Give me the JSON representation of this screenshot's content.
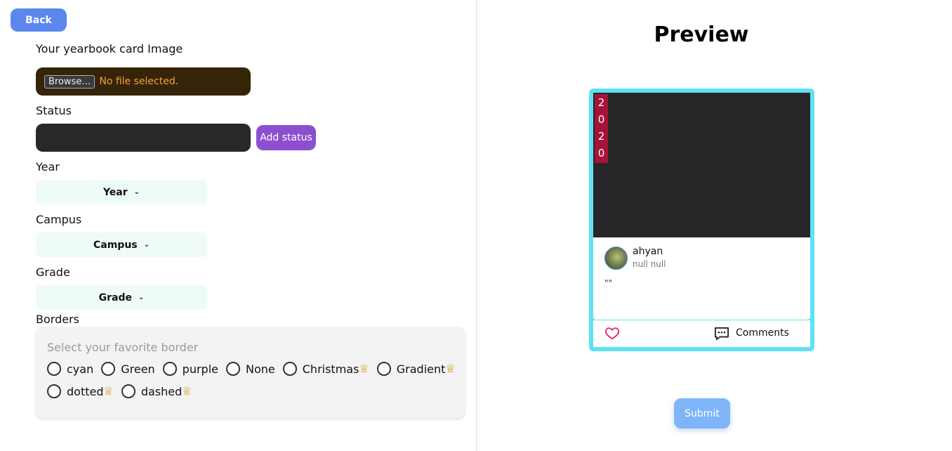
{
  "nav": {
    "back_label": "Back"
  },
  "form": {
    "image_label": "Your yearbook card Image",
    "file_button": "Browse…",
    "file_status": "No file selected.",
    "status_label": "Status",
    "status_value": "",
    "add_status_label": "Add status",
    "year_label": "Year",
    "year_selected": "Year",
    "campus_label": "Campus",
    "campus_selected": "Campus",
    "grade_label": "Grade",
    "grade_selected": "Grade",
    "borders_label": "Borders",
    "borders_hint": "Select your favorite border",
    "border_options": [
      {
        "label": "cyan",
        "premium": false
      },
      {
        "label": "Green",
        "premium": false
      },
      {
        "label": "purple",
        "premium": false
      },
      {
        "label": "None",
        "premium": false
      },
      {
        "label": "Christmas",
        "premium": true
      },
      {
        "label": "Gradient",
        "premium": true
      },
      {
        "label": "dotted",
        "premium": true
      },
      {
        "label": "dashed",
        "premium": true
      }
    ]
  },
  "preview": {
    "title": "Preview",
    "year_badge": [
      "2",
      "0",
      "2",
      "0"
    ],
    "username": "ahyan",
    "subtitle": "null null",
    "quote": "\"\"",
    "comments_label": "Comments",
    "border_color": "#5ee2f3"
  },
  "actions": {
    "submit_label": "Submit"
  },
  "icons": {
    "crown": "crown-icon",
    "heart": "heart-icon",
    "comment": "comment-icon",
    "chevron": "chevron-down-icon"
  }
}
